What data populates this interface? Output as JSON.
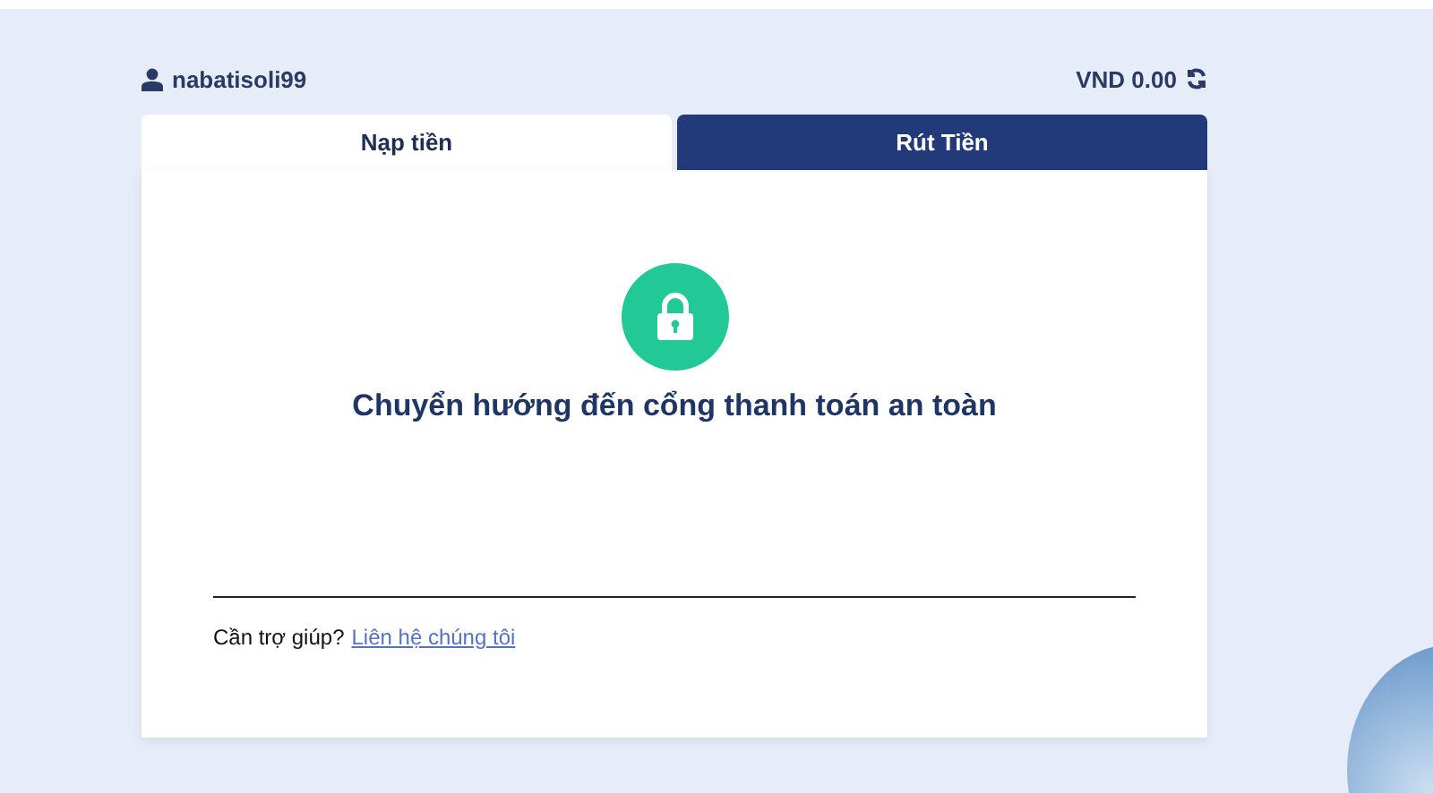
{
  "header": {
    "username": "nabatisoli99",
    "balance": "VND 0.00"
  },
  "tabs": [
    {
      "label": "Nạp tiền",
      "selected": false
    },
    {
      "label": "Rút Tiền",
      "selected": true
    }
  ],
  "message": "Chuyển hướng đến cổng thanh toán an toàn",
  "help": {
    "text": "Cần trợ giúp?",
    "link": "Liên hệ chúng tôi"
  }
}
